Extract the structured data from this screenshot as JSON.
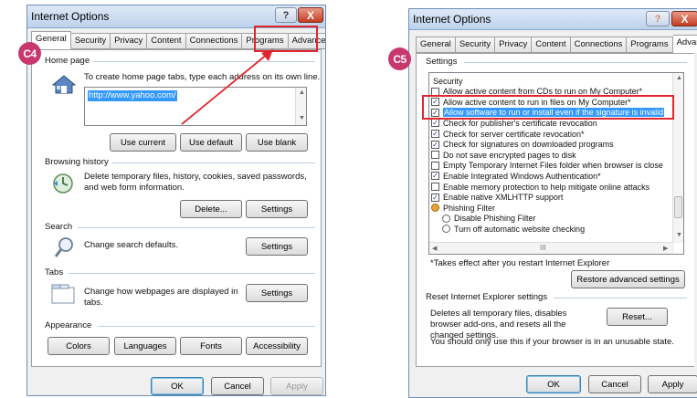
{
  "callouts": {
    "left": "C4",
    "right": "C5"
  },
  "colors": {
    "callout": "#c8376e",
    "highlight_box": "#e0262c",
    "selection": "#3399ff"
  },
  "left": {
    "title": "Internet Options",
    "help": "?",
    "close": "X",
    "tabs": [
      "General",
      "Security",
      "Privacy",
      "Content",
      "Connections",
      "Programs",
      "Advanced"
    ],
    "home_page": {
      "label": "Home page",
      "desc": "To create home page tabs, type each address on its own line.",
      "url": "http://www.yahoo.com/",
      "use_current": "Use current",
      "use_default": "Use default",
      "use_blank": "Use blank"
    },
    "browsing_history": {
      "label": "Browsing history",
      "desc": "Delete temporary files, history, cookies, saved passwords, and web form information.",
      "delete": "Delete...",
      "settings": "Settings"
    },
    "search": {
      "label": "Search",
      "desc": "Change search defaults.",
      "settings": "Settings"
    },
    "tabs_group": {
      "label": "Tabs",
      "desc": "Change how webpages are displayed in tabs.",
      "settings": "Settings"
    },
    "appearance": {
      "label": "Appearance",
      "colors": "Colors",
      "languages": "Languages",
      "fonts": "Fonts",
      "accessibility": "Accessibility"
    },
    "footer": {
      "ok": "OK",
      "cancel": "Cancel",
      "apply": "Apply"
    }
  },
  "right": {
    "title": "Internet Options",
    "help": "?",
    "close": "X",
    "tabs": [
      "General",
      "Security",
      "Privacy",
      "Content",
      "Connections",
      "Programs",
      "Advanced"
    ],
    "settings_label": "Settings",
    "tree": [
      {
        "text": "Security",
        "kind": "header"
      },
      {
        "text": "Allow active content from CDs to run on My Computer*",
        "kind": "cb",
        "checked": false
      },
      {
        "text": "Allow active content to run in files on My Computer*",
        "kind": "cb",
        "checked": true
      },
      {
        "text": "Allow software to run or install even if the signature is invalid",
        "kind": "cb",
        "checked": true,
        "selected": true
      },
      {
        "text": "Check for publisher's certificate revocation",
        "kind": "cb",
        "checked": true
      },
      {
        "text": "Check for server certificate revocation*",
        "kind": "cb",
        "checked": true
      },
      {
        "text": "Check for signatures on downloaded programs",
        "kind": "cb",
        "checked": true
      },
      {
        "text": "Do not save encrypted pages to disk",
        "kind": "cb",
        "checked": false
      },
      {
        "text": "Empty Temporary Internet Files folder when browser is close",
        "kind": "cb",
        "checked": false
      },
      {
        "text": "Enable Integrated Windows Authentication*",
        "kind": "cb",
        "checked": true
      },
      {
        "text": "Enable memory protection to help mitigate online attacks",
        "kind": "cb",
        "checked": false
      },
      {
        "text": "Enable native XMLHTTP support",
        "kind": "cb",
        "checked": true
      },
      {
        "text": "Phishing Filter",
        "kind": "header-icon"
      },
      {
        "text": "Disable Phishing Filter",
        "kind": "radio"
      },
      {
        "text": "Turn off automatic website checking",
        "kind": "radio"
      }
    ],
    "hscroll_mark": "III",
    "takes_effect": "*Takes effect after you restart Internet Explorer",
    "restore": "Restore advanced settings",
    "reset_label": "Reset Internet Explorer settings",
    "reset_desc": "Deletes all temporary files, disables browser add-ons, and resets all the changed settings.",
    "reset_btn": "Reset...",
    "warning": "You should only use this if your browser is in an unusable state.",
    "footer": {
      "ok": "OK",
      "cancel": "Cancel",
      "apply": "Apply"
    }
  }
}
